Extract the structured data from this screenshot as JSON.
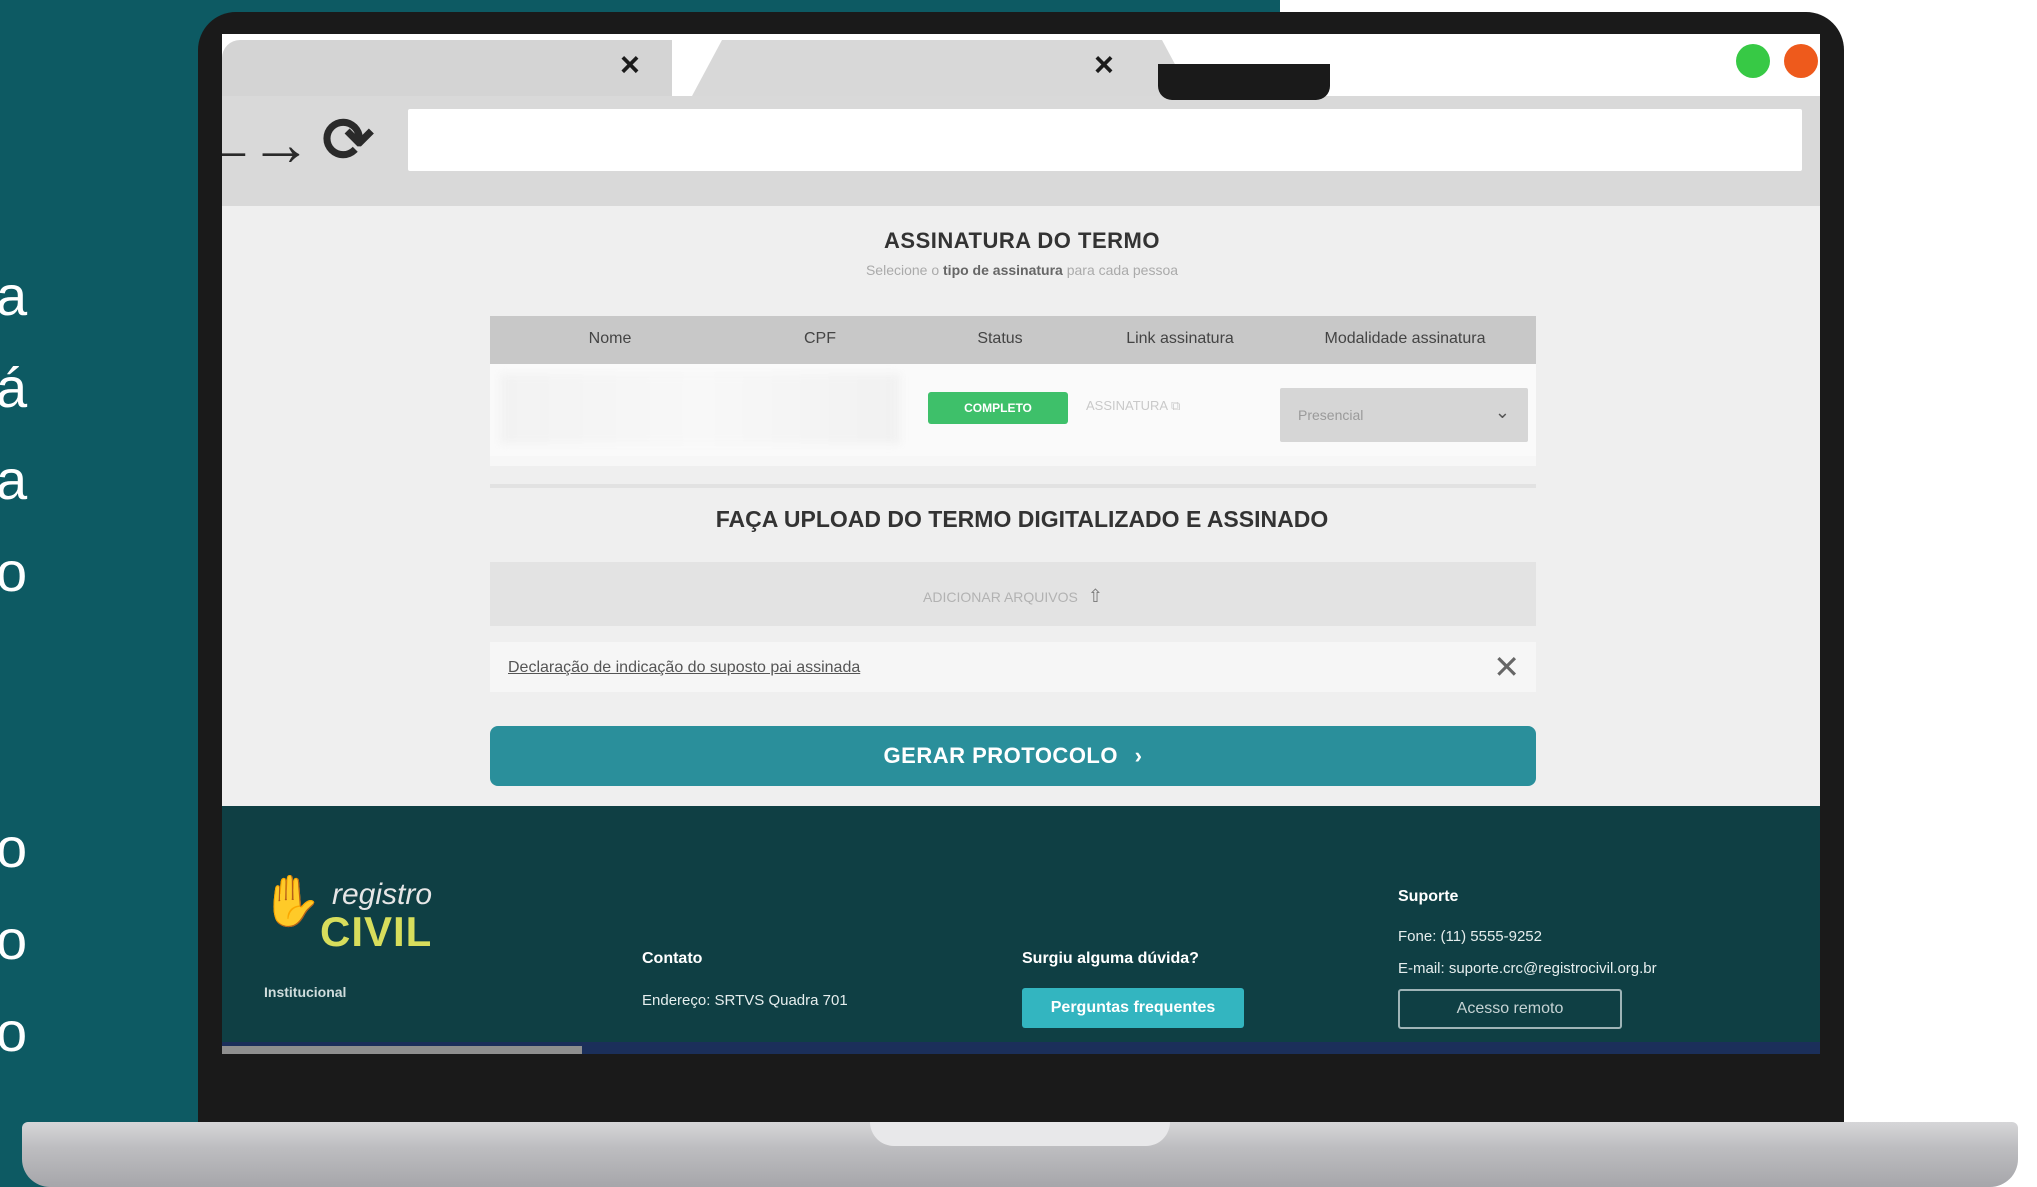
{
  "side_text": {
    "letters": [
      "a",
      "á",
      "a",
      "o",
      "o",
      "o",
      "o"
    ]
  },
  "browser": {
    "tab1_close": "×",
    "tab2_close": "×",
    "back_icon": "←",
    "forward_icon": "→",
    "reload_icon": "⟳",
    "url": "",
    "dot_green": "#37c945",
    "dot_orange": "#ee5a1c"
  },
  "page": {
    "title": "ASSINATURA DO TERMO",
    "subtitle_pre": "Selecione o",
    "subtitle_bold": "tipo de assinatura",
    "subtitle_post": "para cada pessoa",
    "table": {
      "headers": [
        "Nome",
        "CPF",
        "Status",
        "Link assinatura",
        "Modalidade assinatura"
      ],
      "row": {
        "status": "COMPLETO",
        "link": "ASSINATURA",
        "modalidade": "Presencial"
      }
    },
    "upload_title": "FAÇA UPLOAD DO TERMO DIGITALIZADO E ASSINADO",
    "upload_button": "ADICIONAR ARQUIVOS",
    "file_name": "Declaração de indicação do suposto pai assinada",
    "file_close": "✕",
    "submit_label": "GERAR PROTOCOLO",
    "accent_color": "#2a8f9b",
    "status_color": "#3ec06a"
  },
  "footer": {
    "logo_top": "registro",
    "logo_bottom": "CIVIL",
    "institutional": "Institucional",
    "contact": {
      "heading": "Contato",
      "address": "Endereço: SRTVS Quadra 701"
    },
    "faq": {
      "heading": "Surgiu alguma dúvida?",
      "button": "Perguntas frequentes"
    },
    "support": {
      "heading": "Suporte",
      "phone": "Fone: (11) 5555-9252",
      "email": "E-mail: suporte.crc@registrocivil.org.br",
      "remote_button": "Acesso remoto"
    },
    "background": "#0f3f44"
  }
}
